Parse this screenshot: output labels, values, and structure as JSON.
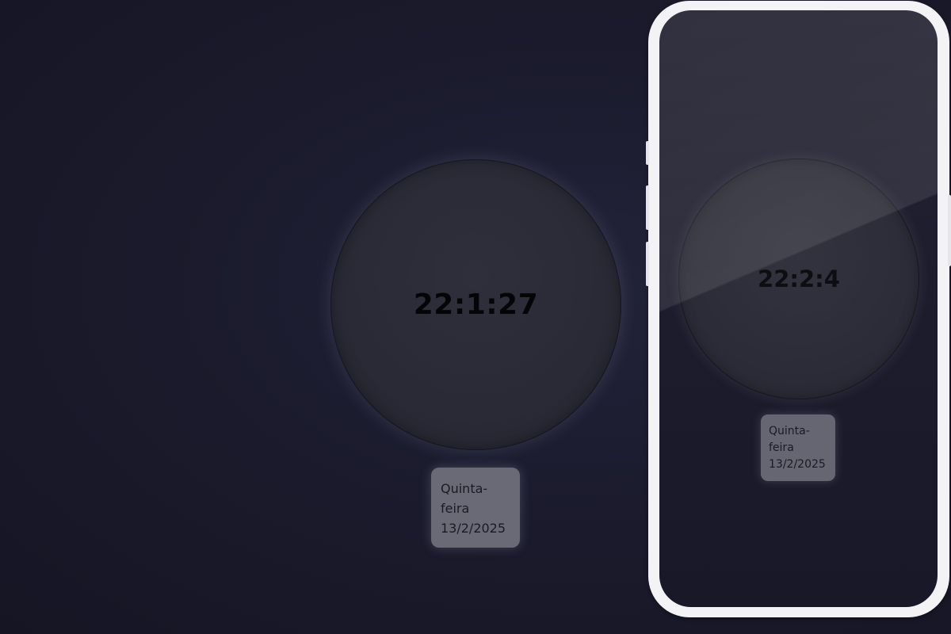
{
  "desktop": {
    "clock": {
      "time": "22:1:27"
    },
    "date": {
      "weekday_line1": "Quinta-",
      "weekday_line2": "feira",
      "date": "13/2/2025"
    }
  },
  "phone": {
    "clock": {
      "time": "22:2:4"
    },
    "date": {
      "weekday_line1": "Quinta-",
      "weekday_line2": "feira",
      "date": "13/2/2025"
    }
  },
  "colors": {
    "background": "#1b1b2d",
    "clock_face": "#2a2a36",
    "date_card": "#6a6a77",
    "phone_frame": "#f3f3f5"
  }
}
